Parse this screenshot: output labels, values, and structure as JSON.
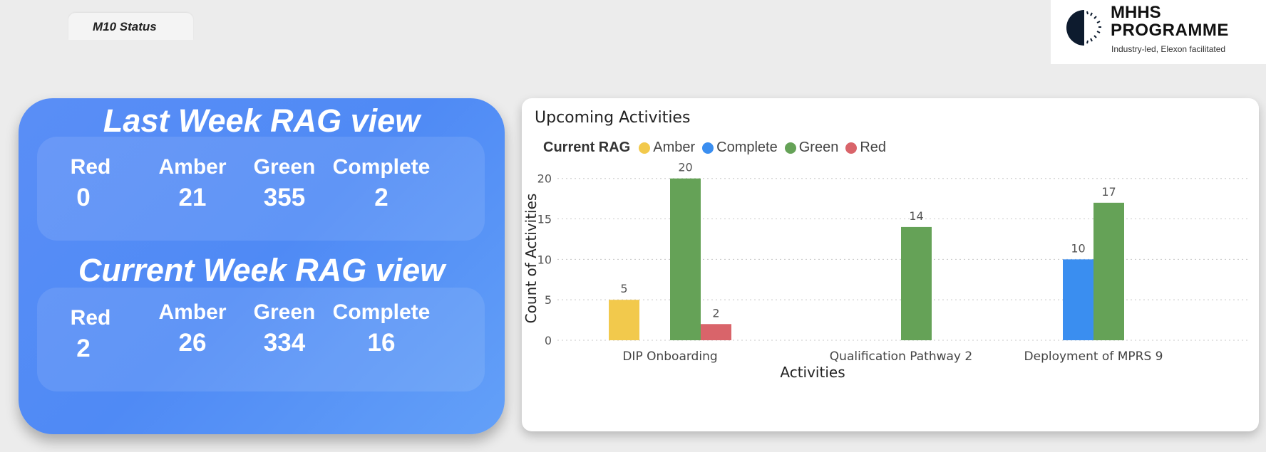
{
  "page": {
    "tab_label": "M10 Status"
  },
  "logo": {
    "line1": "MHHS",
    "line2": "PROGRAMME",
    "tagline": "Industry-led, Elexon facilitated"
  },
  "rag": {
    "last_week": {
      "title": "Last Week RAG view",
      "columns": [
        {
          "label": "Red",
          "value": "0"
        },
        {
          "label": "Amber",
          "value": "21"
        },
        {
          "label": "Green",
          "value": "355"
        },
        {
          "label": "Complete",
          "value": "2"
        }
      ]
    },
    "current_week": {
      "title": "Current Week RAG view",
      "columns": [
        {
          "label": "Red",
          "value": "2"
        },
        {
          "label": "Amber",
          "value": "26"
        },
        {
          "label": "Green",
          "value": "334"
        },
        {
          "label": "Complete",
          "value": "16"
        }
      ]
    }
  },
  "chart_data": {
    "type": "bar",
    "title": "Upcoming Activities",
    "legend_title": "Current RAG",
    "legend_position": "top-left",
    "xlabel": "Activities",
    "ylabel": "Count of Activities",
    "ylim": [
      0,
      22
    ],
    "yticks": [
      0,
      5,
      10,
      15,
      20
    ],
    "grid": true,
    "categories": [
      "DIP Onboarding",
      "Qualification Pathway 2",
      "Deployment of MPRS 9"
    ],
    "series": [
      {
        "name": "Amber",
        "color": "#f2c94c",
        "values": [
          5,
          null,
          null
        ]
      },
      {
        "name": "Complete",
        "color": "#3a8ef0",
        "values": [
          null,
          null,
          10
        ]
      },
      {
        "name": "Green",
        "color": "#65a257",
        "values": [
          20,
          14,
          17
        ]
      },
      {
        "name": "Red",
        "color": "#d9646a",
        "values": [
          2,
          null,
          null
        ]
      }
    ]
  }
}
